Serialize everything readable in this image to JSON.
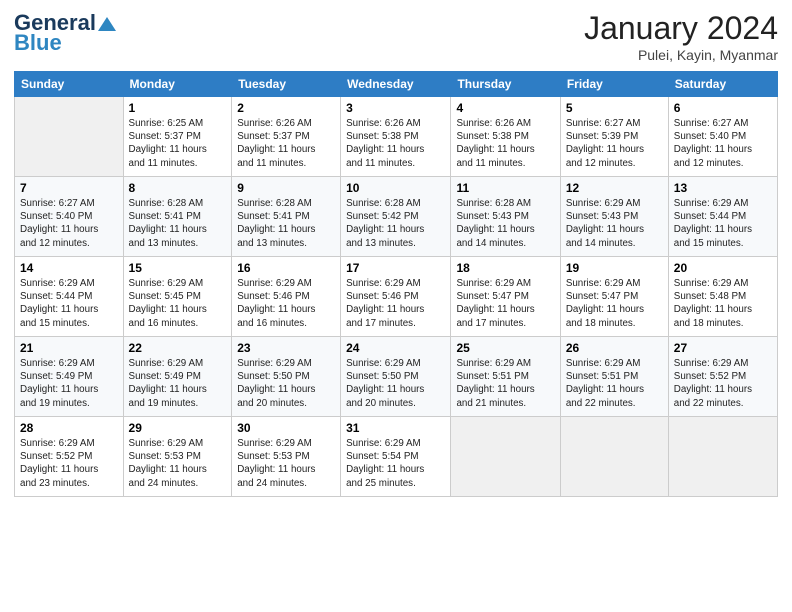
{
  "header": {
    "logo_line1": "General",
    "logo_line2": "Blue",
    "month": "January 2024",
    "location": "Pulei, Kayin, Myanmar"
  },
  "weekdays": [
    "Sunday",
    "Monday",
    "Tuesday",
    "Wednesday",
    "Thursday",
    "Friday",
    "Saturday"
  ],
  "weeks": [
    [
      {
        "day": "",
        "info": ""
      },
      {
        "day": "1",
        "info": "Sunrise: 6:25 AM\nSunset: 5:37 PM\nDaylight: 11 hours\nand 11 minutes."
      },
      {
        "day": "2",
        "info": "Sunrise: 6:26 AM\nSunset: 5:37 PM\nDaylight: 11 hours\nand 11 minutes."
      },
      {
        "day": "3",
        "info": "Sunrise: 6:26 AM\nSunset: 5:38 PM\nDaylight: 11 hours\nand 11 minutes."
      },
      {
        "day": "4",
        "info": "Sunrise: 6:26 AM\nSunset: 5:38 PM\nDaylight: 11 hours\nand 11 minutes."
      },
      {
        "day": "5",
        "info": "Sunrise: 6:27 AM\nSunset: 5:39 PM\nDaylight: 11 hours\nand 12 minutes."
      },
      {
        "day": "6",
        "info": "Sunrise: 6:27 AM\nSunset: 5:40 PM\nDaylight: 11 hours\nand 12 minutes."
      }
    ],
    [
      {
        "day": "7",
        "info": "Sunrise: 6:27 AM\nSunset: 5:40 PM\nDaylight: 11 hours\nand 12 minutes."
      },
      {
        "day": "8",
        "info": "Sunrise: 6:28 AM\nSunset: 5:41 PM\nDaylight: 11 hours\nand 13 minutes."
      },
      {
        "day": "9",
        "info": "Sunrise: 6:28 AM\nSunset: 5:41 PM\nDaylight: 11 hours\nand 13 minutes."
      },
      {
        "day": "10",
        "info": "Sunrise: 6:28 AM\nSunset: 5:42 PM\nDaylight: 11 hours\nand 13 minutes."
      },
      {
        "day": "11",
        "info": "Sunrise: 6:28 AM\nSunset: 5:43 PM\nDaylight: 11 hours\nand 14 minutes."
      },
      {
        "day": "12",
        "info": "Sunrise: 6:29 AM\nSunset: 5:43 PM\nDaylight: 11 hours\nand 14 minutes."
      },
      {
        "day": "13",
        "info": "Sunrise: 6:29 AM\nSunset: 5:44 PM\nDaylight: 11 hours\nand 15 minutes."
      }
    ],
    [
      {
        "day": "14",
        "info": "Sunrise: 6:29 AM\nSunset: 5:44 PM\nDaylight: 11 hours\nand 15 minutes."
      },
      {
        "day": "15",
        "info": "Sunrise: 6:29 AM\nSunset: 5:45 PM\nDaylight: 11 hours\nand 16 minutes."
      },
      {
        "day": "16",
        "info": "Sunrise: 6:29 AM\nSunset: 5:46 PM\nDaylight: 11 hours\nand 16 minutes."
      },
      {
        "day": "17",
        "info": "Sunrise: 6:29 AM\nSunset: 5:46 PM\nDaylight: 11 hours\nand 17 minutes."
      },
      {
        "day": "18",
        "info": "Sunrise: 6:29 AM\nSunset: 5:47 PM\nDaylight: 11 hours\nand 17 minutes."
      },
      {
        "day": "19",
        "info": "Sunrise: 6:29 AM\nSunset: 5:47 PM\nDaylight: 11 hours\nand 18 minutes."
      },
      {
        "day": "20",
        "info": "Sunrise: 6:29 AM\nSunset: 5:48 PM\nDaylight: 11 hours\nand 18 minutes."
      }
    ],
    [
      {
        "day": "21",
        "info": "Sunrise: 6:29 AM\nSunset: 5:49 PM\nDaylight: 11 hours\nand 19 minutes."
      },
      {
        "day": "22",
        "info": "Sunrise: 6:29 AM\nSunset: 5:49 PM\nDaylight: 11 hours\nand 19 minutes."
      },
      {
        "day": "23",
        "info": "Sunrise: 6:29 AM\nSunset: 5:50 PM\nDaylight: 11 hours\nand 20 minutes."
      },
      {
        "day": "24",
        "info": "Sunrise: 6:29 AM\nSunset: 5:50 PM\nDaylight: 11 hours\nand 20 minutes."
      },
      {
        "day": "25",
        "info": "Sunrise: 6:29 AM\nSunset: 5:51 PM\nDaylight: 11 hours\nand 21 minutes."
      },
      {
        "day": "26",
        "info": "Sunrise: 6:29 AM\nSunset: 5:51 PM\nDaylight: 11 hours\nand 22 minutes."
      },
      {
        "day": "27",
        "info": "Sunrise: 6:29 AM\nSunset: 5:52 PM\nDaylight: 11 hours\nand 22 minutes."
      }
    ],
    [
      {
        "day": "28",
        "info": "Sunrise: 6:29 AM\nSunset: 5:52 PM\nDaylight: 11 hours\nand 23 minutes."
      },
      {
        "day": "29",
        "info": "Sunrise: 6:29 AM\nSunset: 5:53 PM\nDaylight: 11 hours\nand 24 minutes."
      },
      {
        "day": "30",
        "info": "Sunrise: 6:29 AM\nSunset: 5:53 PM\nDaylight: 11 hours\nand 24 minutes."
      },
      {
        "day": "31",
        "info": "Sunrise: 6:29 AM\nSunset: 5:54 PM\nDaylight: 11 hours\nand 25 minutes."
      },
      {
        "day": "",
        "info": ""
      },
      {
        "day": "",
        "info": ""
      },
      {
        "day": "",
        "info": ""
      }
    ]
  ]
}
